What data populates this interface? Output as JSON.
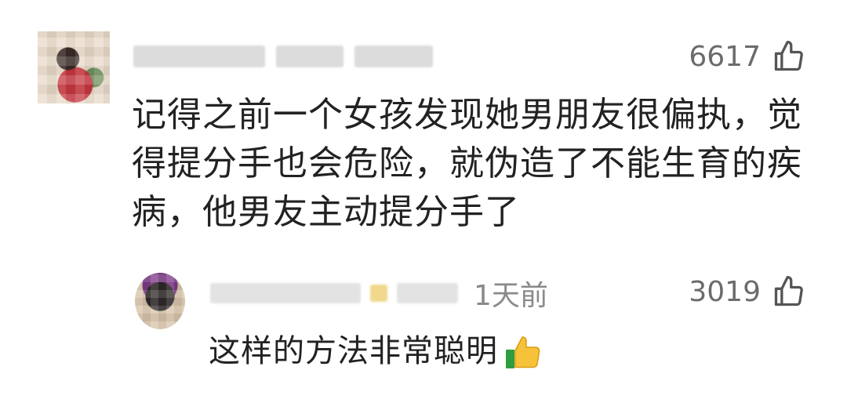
{
  "main_comment": {
    "likes": "6617",
    "text": "记得之前一个女孩发现她男朋友很偏执，觉得提分手也会危险，就伪造了不能生育的疾病，他男友主动提分手了"
  },
  "reply": {
    "time": "1天前",
    "likes": "3019",
    "text": "这样的方法非常聪明"
  },
  "icons": {
    "like": "thumbs-up-outline-icon",
    "emoji": "thumbs-up-emoji-icon"
  },
  "colors": {
    "background": "#ffffff",
    "text": "#222222",
    "muted": "#8a8a8a"
  }
}
